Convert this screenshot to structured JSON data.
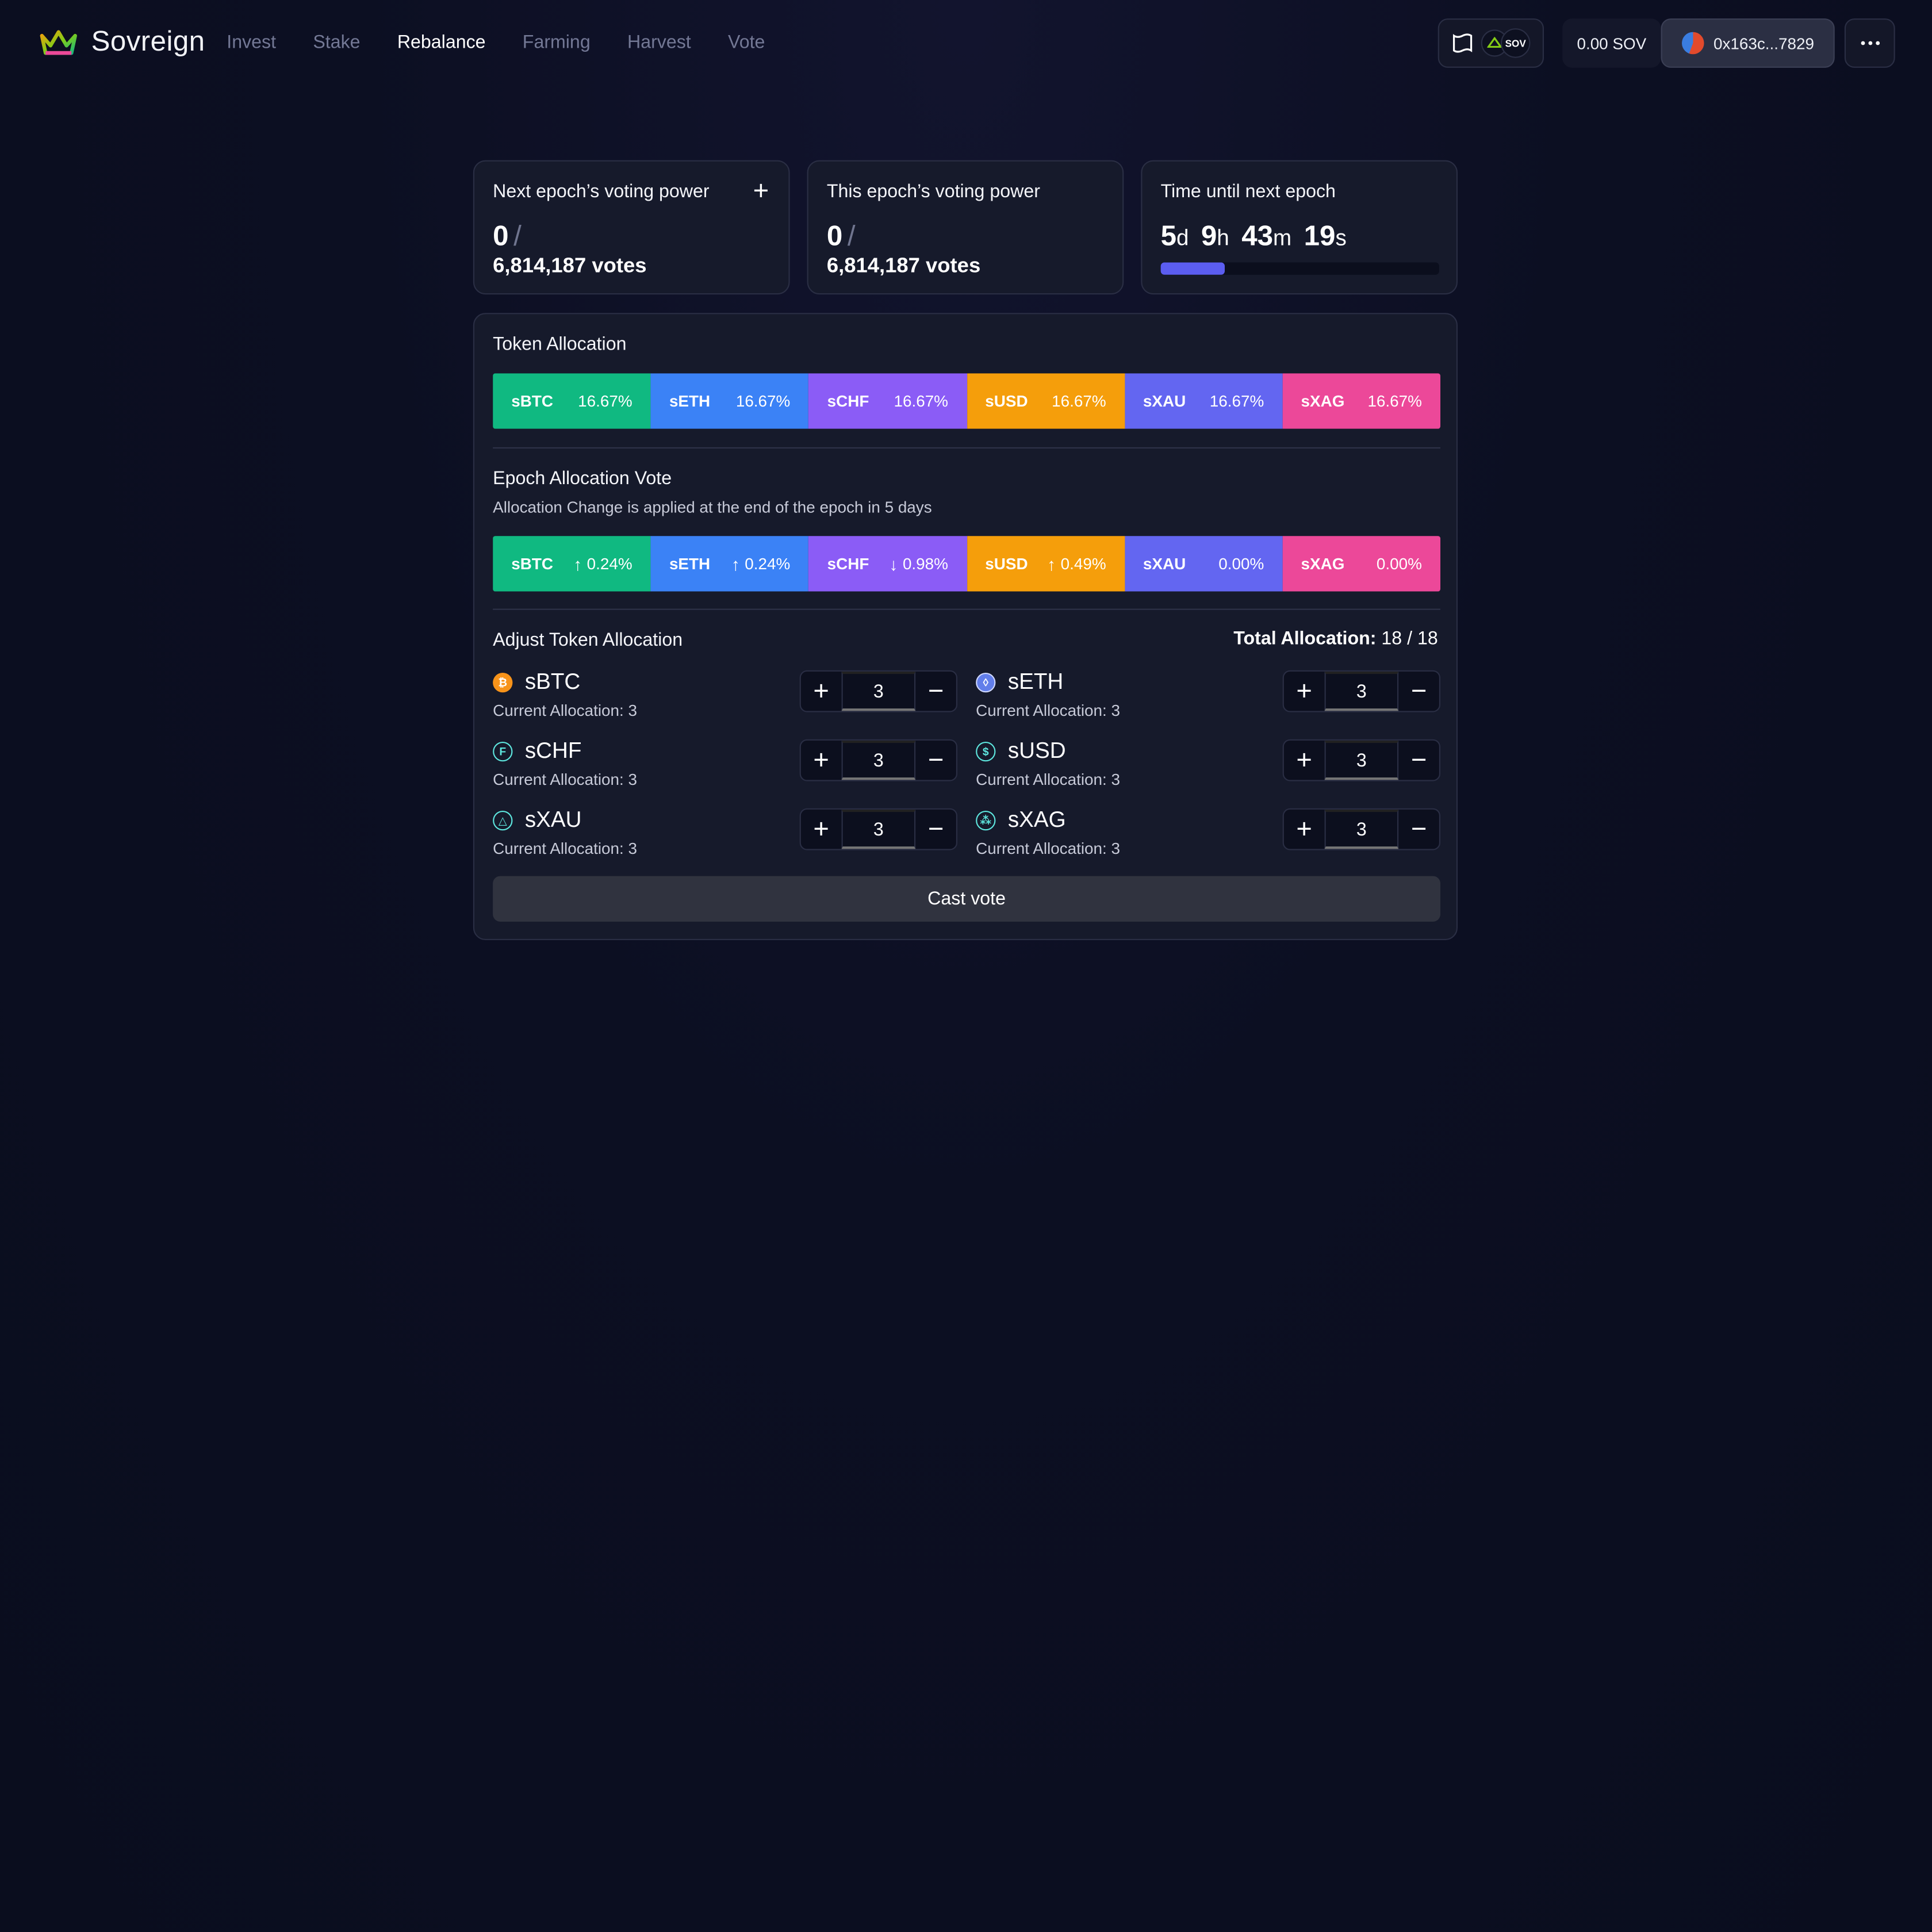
{
  "header": {
    "brand": "Sovreign",
    "nav": [
      {
        "label": "Invest",
        "active": false
      },
      {
        "label": "Stake",
        "active": false
      },
      {
        "label": "Rebalance",
        "active": true
      },
      {
        "label": "Farming",
        "active": false
      },
      {
        "label": "Harvest",
        "active": false
      },
      {
        "label": "Vote",
        "active": false
      }
    ],
    "sov_badge": "SOV",
    "balance": "0.00 SOV",
    "address": "0x163c...7829"
  },
  "stats": {
    "next_power": {
      "title": "Next epoch’s voting power",
      "value": "0",
      "slash": "/",
      "total": "6,814,187 votes"
    },
    "this_power": {
      "title": "This epoch’s voting power",
      "value": "0",
      "slash": "/",
      "total": "6,814,187 votes"
    },
    "epoch": {
      "title": "Time until next epoch",
      "d": "5",
      "d_unit": "d",
      "h": "9",
      "h_unit": "h",
      "m": "43",
      "m_unit": "m",
      "s": "19",
      "s_unit": "s",
      "progress_fraction": 0.23
    }
  },
  "token_allocation": {
    "title": "Token Allocation",
    "segments": [
      {
        "symbol": "sBTC",
        "value": "16.67%",
        "color": "#10b981"
      },
      {
        "symbol": "sETH",
        "value": "16.67%",
        "color": "#3b82f6"
      },
      {
        "symbol": "sCHF",
        "value": "16.67%",
        "color": "#8b5cf6"
      },
      {
        "symbol": "sUSD",
        "value": "16.67%",
        "color": "#f59e0b"
      },
      {
        "symbol": "sXAU",
        "value": "16.67%",
        "color": "#6366f1"
      },
      {
        "symbol": "sXAG",
        "value": "16.67%",
        "color": "#ec4899"
      }
    ]
  },
  "epoch_vote": {
    "title": "Epoch Allocation Vote",
    "subtitle": "Allocation Change is applied at the end of the epoch in 5 days",
    "segments": [
      {
        "symbol": "sBTC",
        "arrow": "↑",
        "value": "0.24%",
        "color": "#10b981"
      },
      {
        "symbol": "sETH",
        "arrow": "↑",
        "value": "0.24%",
        "color": "#3b82f6"
      },
      {
        "symbol": "sCHF",
        "arrow": "↓",
        "value": "0.98%",
        "color": "#8b5cf6"
      },
      {
        "symbol": "sUSD",
        "arrow": "↑",
        "value": "0.49%",
        "color": "#f59e0b"
      },
      {
        "symbol": "sXAU",
        "arrow": "",
        "value": "0.00%",
        "color": "#6366f1"
      },
      {
        "symbol": "sXAG",
        "arrow": "",
        "value": "0.00%",
        "color": "#ec4899"
      }
    ]
  },
  "adjust": {
    "title": "Adjust Token Allocation",
    "total_label": "Total Allocation:",
    "total_value": "18 / 18",
    "current_prefix": "Current Allocation: 3",
    "tokens": [
      {
        "name": "sBTC",
        "icon": "bitcoin-icon",
        "glyph": "₿",
        "icon_color": "#f7931a",
        "current": "Current Allocation: 3",
        "value": "3"
      },
      {
        "name": "sETH",
        "icon": "ethereum-icon",
        "glyph": "◊",
        "icon_color": "#627eea",
        "current": "Current Allocation: 3",
        "value": "3"
      },
      {
        "name": "sCHF",
        "icon": "franc-icon",
        "glyph": "F",
        "icon_color": "#5ee7df",
        "current": "Current Allocation: 3",
        "value": "3"
      },
      {
        "name": "sUSD",
        "icon": "dollar-icon",
        "glyph": "$",
        "icon_color": "#5ee7df",
        "current": "Current Allocation: 3",
        "value": "3"
      },
      {
        "name": "sXAU",
        "icon": "gold-icon",
        "glyph": "△",
        "icon_color": "#5ee7df",
        "current": "Current Allocation: 3",
        "value": "3"
      },
      {
        "name": "sXAG",
        "icon": "silver-icon",
        "glyph": "⁂",
        "icon_color": "#5ee7df",
        "current": "Current Allocation: 3",
        "value": "3"
      }
    ],
    "plus": "+",
    "minus": "−"
  },
  "cast_vote": "Cast vote"
}
